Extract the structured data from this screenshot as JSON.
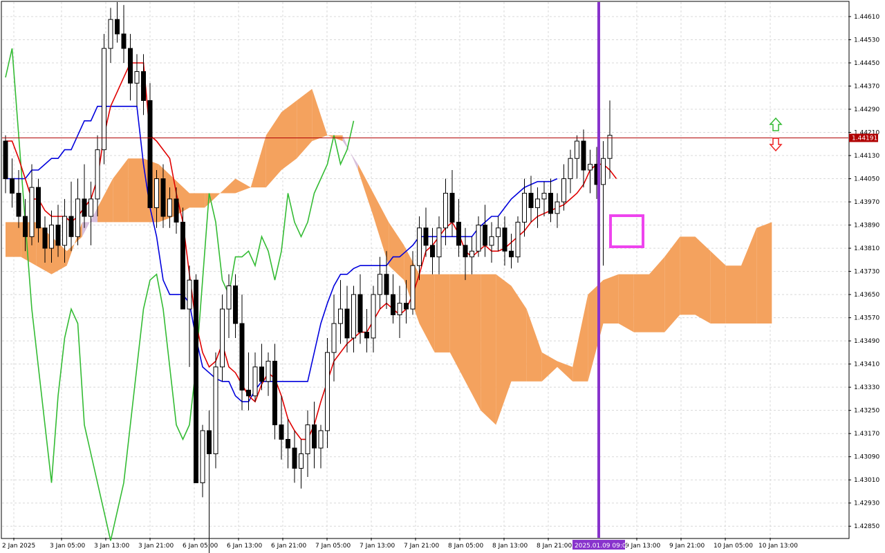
{
  "chart_data": {
    "type": "candlestick",
    "colors": {
      "bull_fill": "#ffffff",
      "bear_fill": "#000000",
      "tenkan": "#e00000",
      "kijun": "#0000dd",
      "chikou": "#33bb33",
      "kumo_bull": "#f4a25e",
      "kumo_bear": "#d7bfdc",
      "current_price_line": "#b00000",
      "vertical_marker": "#8833cc",
      "highlight_box": "#ee44ee",
      "arrow_up": "#33bb33",
      "arrow_down": "#ee2222"
    },
    "y_axis": {
      "range": [
        1.4281,
        1.4466
      ],
      "ticks": [
        "1.44610",
        "1.44530",
        "1.44450",
        "1.44370",
        "1.44290",
        "1.44210",
        "1.44130",
        "1.44050",
        "1.43970",
        "1.43890",
        "1.43810",
        "1.43730",
        "1.43650",
        "1.43570",
        "1.43490",
        "1.43410",
        "1.43330",
        "1.43250",
        "1.43170",
        "1.43090",
        "1.43010",
        "1.42930",
        "1.42850"
      ],
      "current_price_label": "1.44191",
      "current_price": 1.44191
    },
    "x_axis": {
      "ticks": [
        "2 Jan 2025",
        "3 Jan 05:00",
        "3 Jan 13:00",
        "3 Jan 21:00",
        "6 Jan 05:00",
        "6 Jan 13:00",
        "6 Jan 21:00",
        "7 Jan 05:00",
        "7 Jan 13:00",
        "7 Jan 21:00",
        "8 Jan 05:00",
        "8 Jan 13:00",
        "8 Jan 21:00",
        "9 Jan 13:00",
        "9 Jan 21:00",
        "10 Jan 05:00",
        "10 Jan 13:00"
      ],
      "highlight_label": "2025.01.09 09:00"
    },
    "candles": [
      [
        1.4418,
        1.442,
        1.44,
        1.4405
      ],
      [
        1.4405,
        1.4412,
        1.4395,
        1.44
      ],
      [
        1.44,
        1.4408,
        1.4388,
        1.4392
      ],
      [
        1.4392,
        1.4398,
        1.438,
        1.4385
      ],
      [
        1.4385,
        1.441,
        1.4382,
        1.4402
      ],
      [
        1.4402,
        1.4405,
        1.4383,
        1.4388
      ],
      [
        1.4388,
        1.4392,
        1.4376,
        1.4381
      ],
      [
        1.4381,
        1.4394,
        1.4376,
        1.4389
      ],
      [
        1.4389,
        1.4396,
        1.4378,
        1.4382
      ],
      [
        1.4382,
        1.4398,
        1.4376,
        1.4392
      ],
      [
        1.4392,
        1.4404,
        1.438,
        1.4385
      ],
      [
        1.4385,
        1.4405,
        1.4382,
        1.4398
      ],
      [
        1.4398,
        1.441,
        1.4388,
        1.4392
      ],
      [
        1.4392,
        1.4404,
        1.4382,
        1.4398
      ],
      [
        1.4398,
        1.442,
        1.4392,
        1.4415
      ],
      [
        1.4415,
        1.4455,
        1.441,
        1.445
      ],
      [
        1.445,
        1.4464,
        1.4445,
        1.446
      ],
      [
        1.446,
        1.4466,
        1.4452,
        1.4455
      ],
      [
        1.4455,
        1.4465,
        1.4445,
        1.445
      ],
      [
        1.445,
        1.4455,
        1.4432,
        1.4438
      ],
      [
        1.4438,
        1.4448,
        1.443,
        1.4442
      ],
      [
        1.4442,
        1.4448,
        1.4427,
        1.4432
      ],
      [
        1.4432,
        1.4438,
        1.441,
        1.4395
      ],
      [
        1.4395,
        1.4408,
        1.4388,
        1.4405
      ],
      [
        1.4405,
        1.441,
        1.4388,
        1.4392
      ],
      [
        1.4392,
        1.4402,
        1.4388,
        1.4398
      ],
      [
        1.4398,
        1.4402,
        1.4386,
        1.439
      ],
      [
        1.439,
        1.4395,
        1.4378,
        1.436
      ],
      [
        1.436,
        1.4375,
        1.434,
        1.437
      ],
      [
        1.437,
        1.4372,
        1.433,
        1.43
      ],
      [
        1.43,
        1.432,
        1.4295,
        1.4318
      ],
      [
        1.4318,
        1.4325,
        1.427,
        1.431
      ],
      [
        1.431,
        1.4345,
        1.4305,
        1.434
      ],
      [
        1.434,
        1.4365,
        1.4335,
        1.436
      ],
      [
        1.436,
        1.4372,
        1.435,
        1.4368
      ],
      [
        1.4368,
        1.4372,
        1.435,
        1.4355
      ],
      [
        1.4355,
        1.4365,
        1.4325,
        1.4332
      ],
      [
        1.4332,
        1.4345,
        1.4325,
        1.433
      ],
      [
        1.433,
        1.4345,
        1.4328,
        1.434
      ],
      [
        1.434,
        1.4348,
        1.4332,
        1.4335
      ],
      [
        1.4335,
        1.4345,
        1.433,
        1.4342
      ],
      [
        1.4342,
        1.4348,
        1.4315,
        1.432
      ],
      [
        1.432,
        1.433,
        1.4308,
        1.4315
      ],
      [
        1.4315,
        1.4322,
        1.4305,
        1.4312
      ],
      [
        1.4312,
        1.4318,
        1.43,
        1.4305
      ],
      [
        1.4305,
        1.4315,
        1.4298,
        1.431
      ],
      [
        1.431,
        1.4325,
        1.4302,
        1.432
      ],
      [
        1.432,
        1.4328,
        1.4305,
        1.4312
      ],
      [
        1.4312,
        1.432,
        1.4305,
        1.4318
      ],
      [
        1.4318,
        1.435,
        1.4312,
        1.4345
      ],
      [
        1.4345,
        1.4365,
        1.4335,
        1.4355
      ],
      [
        1.4355,
        1.437,
        1.4348,
        1.436
      ],
      [
        1.436,
        1.4368,
        1.4345,
        1.435
      ],
      [
        1.435,
        1.4368,
        1.4345,
        1.4365
      ],
      [
        1.4365,
        1.4372,
        1.4348,
        1.4352
      ],
      [
        1.4352,
        1.436,
        1.4345,
        1.435
      ],
      [
        1.435,
        1.4368,
        1.4345,
        1.4365
      ],
      [
        1.4365,
        1.4378,
        1.436,
        1.4372
      ],
      [
        1.4372,
        1.438,
        1.436,
        1.4365
      ],
      [
        1.4365,
        1.4372,
        1.4355,
        1.4358
      ],
      [
        1.4358,
        1.4368,
        1.435,
        1.4362
      ],
      [
        1.4362,
        1.437,
        1.4355,
        1.436
      ],
      [
        1.436,
        1.438,
        1.4358,
        1.4375
      ],
      [
        1.4375,
        1.4392,
        1.437,
        1.4388
      ],
      [
        1.4388,
        1.4395,
        1.4378,
        1.4382
      ],
      [
        1.4382,
        1.4388,
        1.4372,
        1.4378
      ],
      [
        1.4378,
        1.4392,
        1.4372,
        1.4388
      ],
      [
        1.4388,
        1.4405,
        1.4382,
        1.44
      ],
      [
        1.44,
        1.4408,
        1.4385,
        1.439
      ],
      [
        1.439,
        1.4398,
        1.4378,
        1.4382
      ],
      [
        1.4382,
        1.4388,
        1.437,
        1.4378
      ],
      [
        1.4378,
        1.4385,
        1.4372,
        1.438
      ],
      [
        1.438,
        1.4392,
        1.4378,
        1.4389
      ],
      [
        1.4389,
        1.4396,
        1.4378,
        1.4382
      ],
      [
        1.4382,
        1.439,
        1.4376,
        1.4385
      ],
      [
        1.4385,
        1.4392,
        1.438,
        1.4388
      ],
      [
        1.4388,
        1.4392,
        1.4375,
        1.438
      ],
      [
        1.438,
        1.4386,
        1.4374,
        1.4378
      ],
      [
        1.4378,
        1.4392,
        1.4376,
        1.439
      ],
      [
        1.439,
        1.4405,
        1.4385,
        1.44
      ],
      [
        1.44,
        1.4406,
        1.439,
        1.4395
      ],
      [
        1.4395,
        1.4402,
        1.4388,
        1.4398
      ],
      [
        1.4398,
        1.4404,
        1.4392,
        1.44
      ],
      [
        1.44,
        1.4405,
        1.439,
        1.4393
      ],
      [
        1.4393,
        1.44,
        1.4388,
        1.4397
      ],
      [
        1.4397,
        1.441,
        1.4394,
        1.4405
      ],
      [
        1.4405,
        1.4415,
        1.44,
        1.4412
      ],
      [
        1.4412,
        1.442,
        1.4405,
        1.4418
      ],
      [
        1.4418,
        1.4422,
        1.4402,
        1.4408
      ],
      [
        1.4408,
        1.4415,
        1.44,
        1.441
      ],
      [
        1.441,
        1.4416,
        1.4398,
        1.4403
      ],
      [
        1.4403,
        1.4418,
        1.4375,
        1.4412
      ],
      [
        1.4412,
        1.4432,
        1.4405,
        1.442
      ]
    ],
    "tenkan": [
      1.4418,
      1.4418,
      1.4412,
      1.4405,
      1.4398,
      1.4398,
      1.4394,
      1.4392,
      1.4392,
      1.4392,
      1.439,
      1.4392,
      1.4395,
      1.4398,
      1.4405,
      1.442,
      1.443,
      1.4435,
      1.444,
      1.4445,
      1.4445,
      1.4445,
      1.442,
      1.4418,
      1.4415,
      1.4412,
      1.44,
      1.439,
      1.4372,
      1.4355,
      1.4345,
      1.434,
      1.4342,
      1.4348,
      1.434,
      1.4338,
      1.4334,
      1.433,
      1.4328,
      1.4334,
      1.4338,
      1.4336,
      1.433,
      1.4322,
      1.4318,
      1.4315,
      1.4315,
      1.432,
      1.4328,
      1.4335,
      1.4342,
      1.4345,
      1.4348,
      1.435,
      1.4352,
      1.4352,
      1.4356,
      1.436,
      1.4362,
      1.436,
      1.4358,
      1.436,
      1.4365,
      1.4372,
      1.438,
      1.4382,
      1.4385,
      1.4388,
      1.439,
      1.4386,
      1.438,
      1.4378,
      1.438,
      1.4382,
      1.438,
      1.438,
      1.4381,
      1.4383,
      1.4385,
      1.4387,
      1.439,
      1.4392,
      1.4393,
      1.4394,
      1.4395,
      1.4396,
      1.4398,
      1.44,
      1.4403,
      1.4408,
      1.441,
      1.441,
      1.4408,
      1.4405
    ],
    "kijun": [
      1.4405,
      1.4405,
      1.4405,
      1.4405,
      1.4408,
      1.4408,
      1.441,
      1.4412,
      1.4412,
      1.4415,
      1.4415,
      1.442,
      1.4425,
      1.4425,
      1.443,
      1.443,
      1.443,
      1.443,
      1.443,
      1.443,
      1.443,
      1.441,
      1.4395,
      1.4385,
      1.437,
      1.4365,
      1.4365,
      1.4365,
      1.4362,
      1.435,
      1.434,
      1.4338,
      1.4336,
      1.4335,
      1.4335,
      1.433,
      1.4328,
      1.4328,
      1.4332,
      1.4335,
      1.4335,
      1.4335,
      1.4335,
      1.4335,
      1.4335,
      1.4335,
      1.4335,
      1.4345,
      1.4355,
      1.4362,
      1.4368,
      1.4372,
      1.4372,
      1.4374,
      1.4375,
      1.4375,
      1.4375,
      1.4375,
      1.4375,
      1.4378,
      1.4378,
      1.438,
      1.4382,
      1.4385,
      1.4385,
      1.4385,
      1.4385,
      1.4385,
      1.4385,
      1.4385,
      1.4385,
      1.4385,
      1.4388,
      1.439,
      1.4392,
      1.4392,
      1.4395,
      1.4398,
      1.44,
      1.4402,
      1.4403,
      1.4404,
      1.4404,
      1.4404,
      1.4405
    ],
    "chikou": [
      1.444,
      1.445,
      1.442,
      1.439,
      1.436,
      1.434,
      1.432,
      1.43,
      1.433,
      1.435,
      1.436,
      1.4355,
      1.432,
      1.431,
      1.43,
      1.429,
      1.428,
      1.429,
      1.43,
      1.432,
      1.434,
      1.436,
      1.437,
      1.4372,
      1.436,
      1.434,
      1.432,
      1.4315,
      1.432,
      1.434,
      1.437,
      1.44,
      1.439,
      1.437,
      1.4365,
      1.4378,
      1.4378,
      1.438,
      1.4375,
      1.4385,
      1.438,
      1.437,
      1.438,
      1.44,
      1.439,
      1.4385,
      1.439,
      1.44,
      1.4405,
      1.441,
      1.442,
      1.441,
      1.4415,
      1.4425
    ],
    "kumo": [
      [
        1.439,
        1.4378
      ],
      [
        1.439,
        1.4378
      ],
      [
        1.439,
        1.4375
      ],
      [
        1.4385,
        1.4372
      ],
      [
        1.438,
        1.4375
      ],
      [
        1.4385,
        1.439
      ],
      [
        1.4395,
        1.439
      ],
      [
        1.4405,
        1.439
      ],
      [
        1.4412,
        1.439
      ],
      [
        1.4412,
        1.439
      ],
      [
        1.441,
        1.439
      ],
      [
        1.4405,
        1.4392
      ],
      [
        1.44,
        1.4395
      ],
      [
        1.44,
        1.4395
      ],
      [
        1.44,
        1.44
      ],
      [
        1.4405,
        1.44
      ],
      [
        1.4402,
        1.4402
      ],
      [
        1.442,
        1.4402
      ],
      [
        1.4428,
        1.4408
      ],
      [
        1.4432,
        1.4412
      ],
      [
        1.4436,
        1.4418
      ],
      [
        1.442,
        1.442
      ],
      [
        1.4418,
        1.442
      ],
      [
        1.441,
        1.4408
      ],
      [
        1.44,
        1.4392
      ],
      [
        1.439,
        1.4375
      ],
      [
        1.4382,
        1.437
      ],
      [
        1.4372,
        1.4355
      ],
      [
        1.4372,
        1.4345
      ],
      [
        1.4372,
        1.4345
      ],
      [
        1.4372,
        1.4335
      ],
      [
        1.4372,
        1.4325
      ],
      [
        1.4372,
        1.432
      ],
      [
        1.4368,
        1.4335
      ],
      [
        1.436,
        1.4335
      ],
      [
        1.4345,
        1.4335
      ],
      [
        1.4342,
        1.434
      ],
      [
        1.434,
        1.4335
      ],
      [
        1.4365,
        1.4335
      ],
      [
        1.437,
        1.4355
      ],
      [
        1.4372,
        1.4355
      ],
      [
        1.4372,
        1.4352
      ],
      [
        1.4372,
        1.4352
      ],
      [
        1.4378,
        1.4352
      ],
      [
        1.4385,
        1.4358
      ],
      [
        1.4385,
        1.4358
      ],
      [
        1.438,
        1.4355
      ],
      [
        1.4375,
        1.4355
      ],
      [
        1.4375,
        1.4355
      ],
      [
        1.4388,
        1.4355
      ],
      [
        1.439,
        1.4355
      ]
    ]
  }
}
